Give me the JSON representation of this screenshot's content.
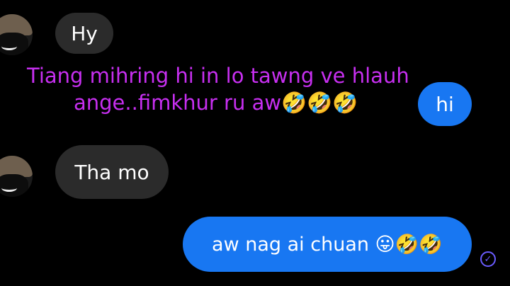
{
  "messages": [
    {
      "side": "in",
      "text": "Hy"
    },
    {
      "side": "out",
      "text": "hi"
    },
    {
      "side": "in",
      "text": "Tha mo"
    },
    {
      "side": "out",
      "text": "aw nag ai chuan 😛🤣🤣"
    }
  ],
  "caption": {
    "line1": "Tiang mihring hi in lo tawng ve hlauh",
    "line2": "ange..fimkhur ru aw🤣🤣🤣"
  },
  "overlay_emoji": {
    "tears_of_joy": "😂",
    "grinning_squint": "😆"
  },
  "read_receipt_icon": "check-circle-icon",
  "colors": {
    "incoming_bubble": "#2b2b2b",
    "outgoing_bubble": "#1877f2",
    "caption": "#c72ff0",
    "receipt": "#6a5cff"
  }
}
